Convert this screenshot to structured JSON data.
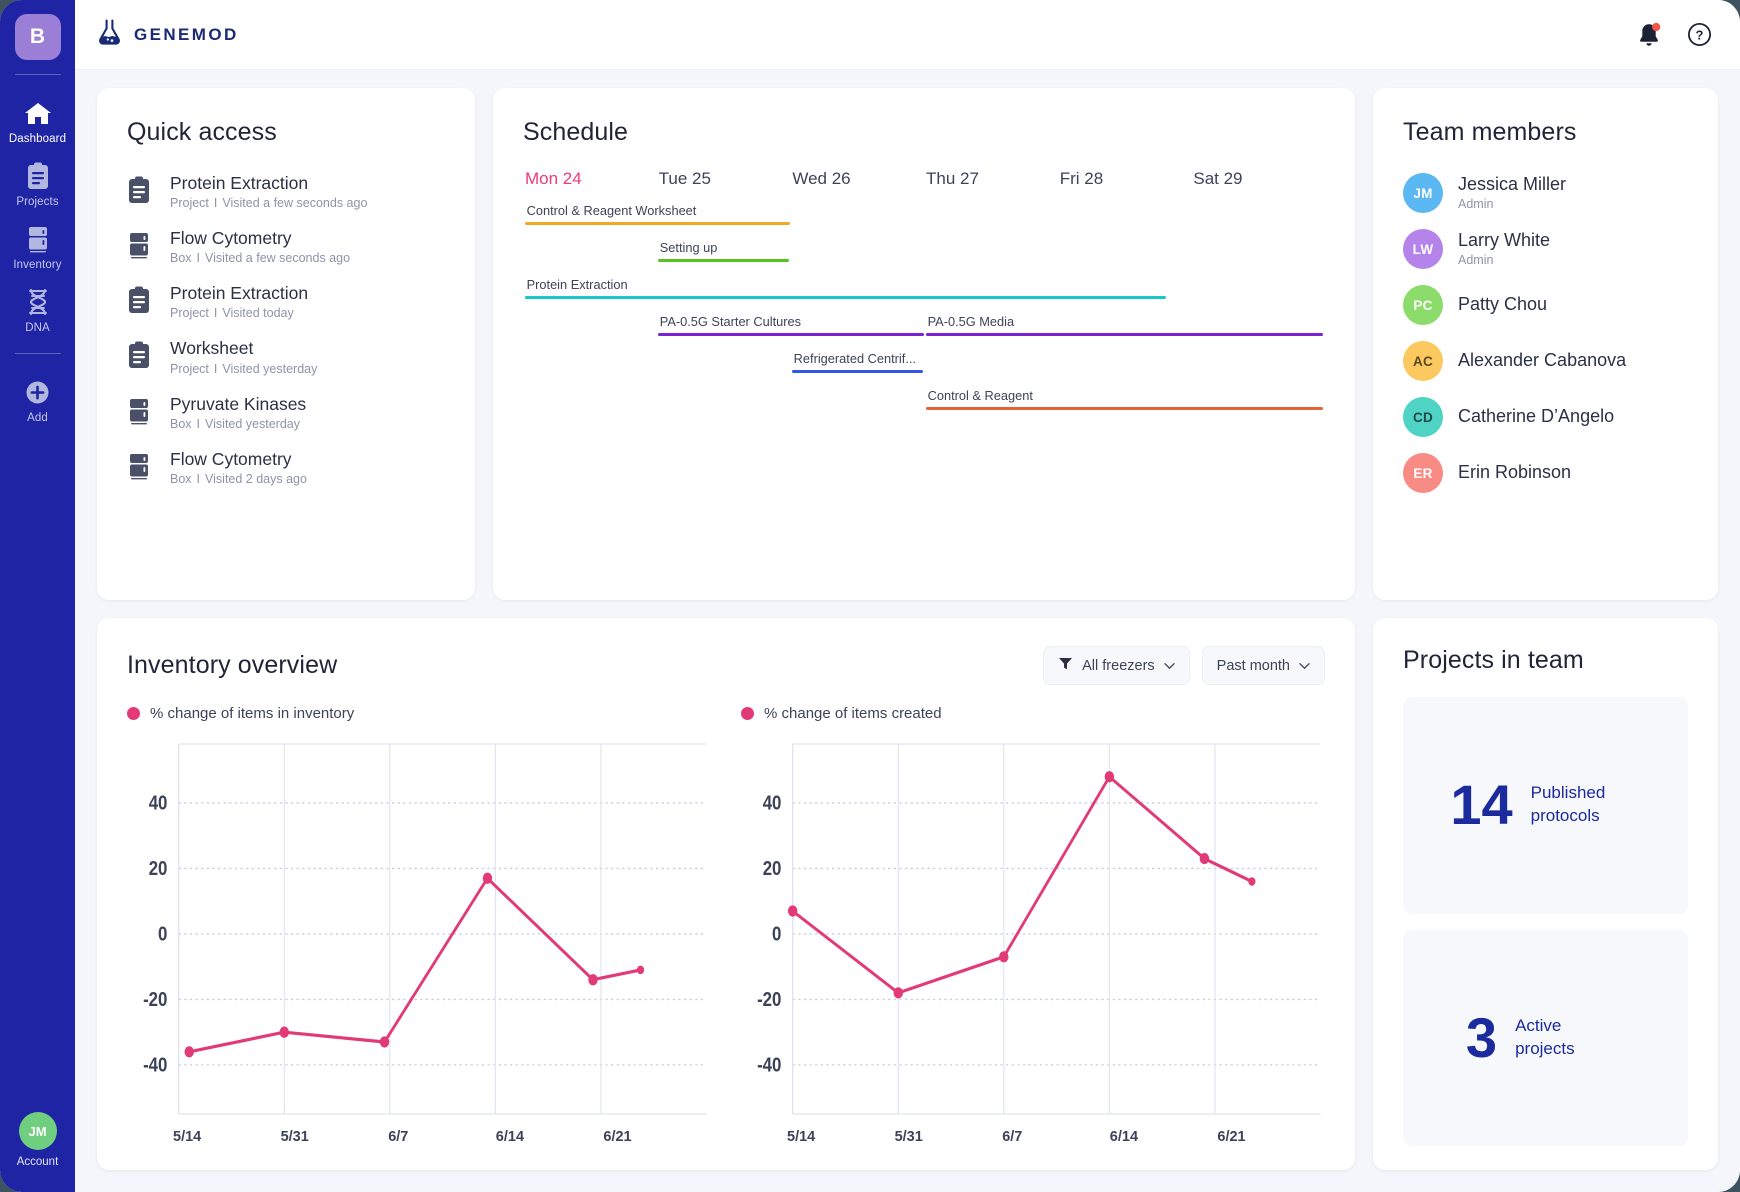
{
  "sidebar": {
    "workspace_badge": "B",
    "items": [
      {
        "label": "Dashboard",
        "icon": "home-icon",
        "active": true
      },
      {
        "label": "Projects",
        "icon": "clipboard-icon",
        "active": false
      },
      {
        "label": "Inventory",
        "icon": "freezer-icon",
        "active": false
      },
      {
        "label": "DNA",
        "icon": "dna-icon",
        "active": false
      },
      {
        "label": "Add",
        "icon": "plus-circle-icon",
        "active": false
      }
    ],
    "account": {
      "initials": "JM",
      "label": "Account",
      "color": "#6fcf7f"
    }
  },
  "topbar": {
    "logo_text": "GENEMOD",
    "notification_icon": "bell-icon",
    "help_icon": "question-circle-icon",
    "has_notification": true
  },
  "quick_access": {
    "title": "Quick access",
    "items": [
      {
        "name": "Protein Extraction",
        "type": "Project",
        "visited": "Visited a few seconds ago",
        "icon": "clipboard-icon"
      },
      {
        "name": "Flow Cytometry",
        "type": "Box",
        "visited": "Visited a few seconds ago",
        "icon": "box-icon"
      },
      {
        "name": "Protein Extraction",
        "type": "Project",
        "visited": "Visited today",
        "icon": "clipboard-icon"
      },
      {
        "name": "Worksheet",
        "type": "Project",
        "visited": "Visited yesterday",
        "icon": "clipboard-icon"
      },
      {
        "name": "Pyruvate Kinases",
        "type": "Box",
        "visited": "Visited yesterday",
        "icon": "box-icon"
      },
      {
        "name": "Flow Cytometry",
        "type": "Box",
        "visited": "Visited 2 days ago",
        "icon": "box-icon"
      }
    ],
    "separator": "I"
  },
  "schedule": {
    "title": "Schedule",
    "days": [
      {
        "label": "Mon 24",
        "today": true
      },
      {
        "label": "Tue 25",
        "today": false
      },
      {
        "label": "Wed 26",
        "today": false
      },
      {
        "label": "Thu 27",
        "today": false
      },
      {
        "label": "Fri 28",
        "today": false
      },
      {
        "label": "Sat 29",
        "today": false
      }
    ],
    "events": [
      {
        "label": "Control & Reagent Worksheet",
        "color": "#f5a623",
        "start_day": 0,
        "span": 2,
        "row": 0
      },
      {
        "label": "Setting up",
        "color": "#56c321",
        "start_day": 1,
        "span": 1,
        "row": 1
      },
      {
        "label": "Protein Extraction",
        "color": "#17c8c8",
        "start_day": 0,
        "span": 4,
        "row": 2
      },
      {
        "label": "PA-0.5G Starter Cultures",
        "color": "#7a22d4",
        "start_day": 1,
        "span": 2,
        "row": 3
      },
      {
        "label": "PA-0.5G Media",
        "color": "#7a22d4",
        "start_day": 3,
        "span": 2,
        "row": 3
      },
      {
        "label": "Refrigerated Centrif...",
        "color": "#3457e8",
        "start_day": 2,
        "span": 1,
        "row": 4
      },
      {
        "label": "Control & Reagent",
        "color": "#e26436",
        "start_day": 3,
        "span": 2,
        "row": 5
      }
    ]
  },
  "team": {
    "title": "Team members",
    "members": [
      {
        "initials": "JM",
        "name": "Jessica Miller",
        "role": "Admin",
        "color": "#5cb8f2"
      },
      {
        "initials": "LW",
        "name": "Larry White",
        "role": "Admin",
        "color": "#b484ea"
      },
      {
        "initials": "PC",
        "name": "Patty Chou",
        "role": "",
        "color": "#8bdc6b"
      },
      {
        "initials": "AC",
        "name": "Alexander Cabanova",
        "role": "",
        "color": "#fcc860"
      },
      {
        "initials": "CD",
        "name": "Catherine D’Angelo",
        "role": "",
        "color": "#4ed3c5"
      },
      {
        "initials": "ER",
        "name": "Erin Robinson",
        "role": "",
        "color": "#f98b85"
      }
    ]
  },
  "inventory": {
    "title": "Inventory overview",
    "filter_freezer": {
      "label": "All freezers",
      "icon": "filter-icon",
      "chevron": "chevron-down-icon"
    },
    "filter_period": {
      "label": "Past month",
      "chevron": "chevron-down-icon"
    }
  },
  "chart_data": [
    {
      "type": "line",
      "title": "% change of items in inventory",
      "series_color": "#e23a77",
      "x": [
        "5/14",
        "5/31",
        "6/7",
        "6/14",
        "6/21"
      ],
      "tick_labels": [
        "5/14",
        "5/31",
        "6/7",
        "6/14",
        "6/21"
      ],
      "values": [
        -36,
        -30,
        -33,
        17,
        -14,
        -11
      ],
      "point_x": [
        0.02,
        0.2,
        0.39,
        0.585,
        0.785,
        0.875
      ],
      "ylabel": "",
      "xlabel": "",
      "ytick_labels": [
        "40",
        "20",
        "0",
        "-20",
        "-40"
      ],
      "yticks": [
        40,
        20,
        0,
        -20,
        -40
      ],
      "ylim": [
        -55,
        58
      ],
      "grid": true,
      "legend": "% change of items in inventory",
      "legend_position": "top-left"
    },
    {
      "type": "line",
      "title": "% change of items created",
      "series_color": "#e23a77",
      "x": [
        "5/14",
        "5/31",
        "6/7",
        "6/14",
        "6/21"
      ],
      "tick_labels": [
        "5/14",
        "5/31",
        "6/7",
        "6/14",
        "6/21"
      ],
      "values": [
        7,
        -18,
        -7,
        48,
        23,
        16
      ],
      "point_x": [
        0.0,
        0.2,
        0.4,
        0.6,
        0.78,
        0.87
      ],
      "ylabel": "",
      "xlabel": "",
      "ytick_labels": [
        "40",
        "20",
        "0",
        "-20",
        "-40"
      ],
      "yticks": [
        40,
        20,
        0,
        -20,
        -40
      ],
      "ylim": [
        -55,
        58
      ],
      "grid": true,
      "legend": "% change of items created",
      "legend_position": "top-left"
    }
  ],
  "projects": {
    "title": "Projects in team",
    "tiles": [
      {
        "number": "14",
        "label": "Published protocols"
      },
      {
        "number": "3",
        "label": "Active projects"
      }
    ]
  }
}
